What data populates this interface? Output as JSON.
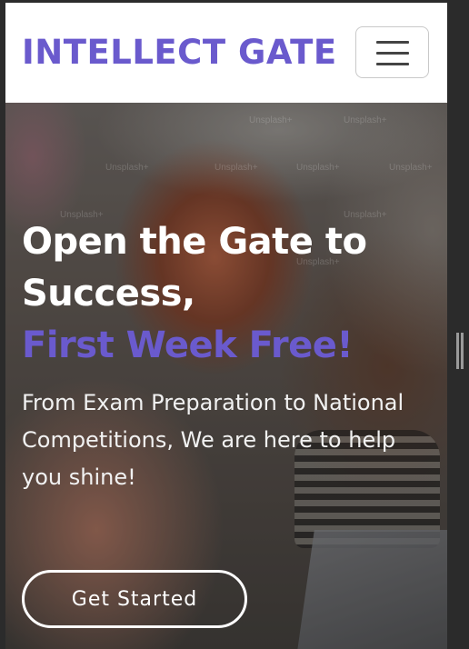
{
  "navbar": {
    "brand": "INTELLECT GATE",
    "brand_color": "#6a5acd",
    "toggler_icon": "hamburger-menu-icon"
  },
  "hero": {
    "title_line1": "Open the Gate to",
    "title_line2": "Success,",
    "title_accent": "First Week Free!",
    "accent_color": "#6a5acd",
    "subtitle": "From Exam Preparation to National Competitions, We are here to help you shine!",
    "cta_label": "Get Started",
    "watermark": "Unsplash+"
  },
  "window": {
    "resize_handle_icon": "resize-grip-icon"
  }
}
